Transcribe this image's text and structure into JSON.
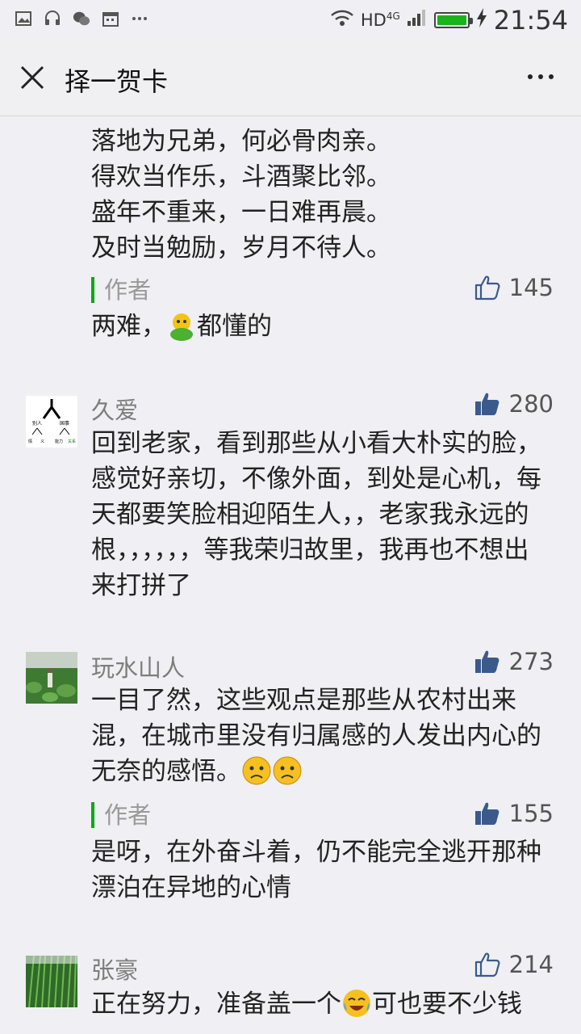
{
  "status_bar": {
    "network": "HD",
    "network_sup": "4G",
    "time": "21:54"
  },
  "header": {
    "title": "择一贺卡"
  },
  "poem_lines": [
    "落地为兄弟，何必骨肉亲。",
    "得欢当作乐，斗酒聚比邻。",
    "盛年不重来，一日难再晨。",
    "及时当勉励，岁月不待人。"
  ],
  "comments": [
    {
      "author_reply": {
        "label": "作者",
        "likes": "145",
        "text_before": "两难，",
        "text_after": "都懂的"
      }
    },
    {
      "user": "久爱",
      "likes": "280",
      "text": "回到老家，看到那些从小看大朴实的脸，感觉好亲切，不像外面，到处是心机，每天都要笑脸相迎陌生人，，老家我永远的根，，，，，，等我荣归故里，我再也不想出来打拼了",
      "avatar_text": {
        "top": "人",
        "left": "别人",
        "right": "国事",
        "b1": "情",
        "b2": "义",
        "b3": "能力",
        "b4": "关系"
      }
    },
    {
      "user": "玩水山人",
      "likes": "273",
      "text": "一目了然，这些观点是那些从农村出来混，在城市里没有归属感的人发出内心的无奈的感悟。",
      "author_reply": {
        "label": "作者",
        "likes": "155",
        "text": "是呀，在外奋斗着，仍不能完全逃开那种漂泊在异地的心情"
      }
    },
    {
      "user": "张豪",
      "likes": "214",
      "text_before": "正在努力，准备盖一个",
      "text_after": "可也要不少钱"
    }
  ],
  "colors": {
    "accent_green": "#0aa818",
    "background": "#efeff4",
    "like_icon": "#3a5a8c"
  }
}
